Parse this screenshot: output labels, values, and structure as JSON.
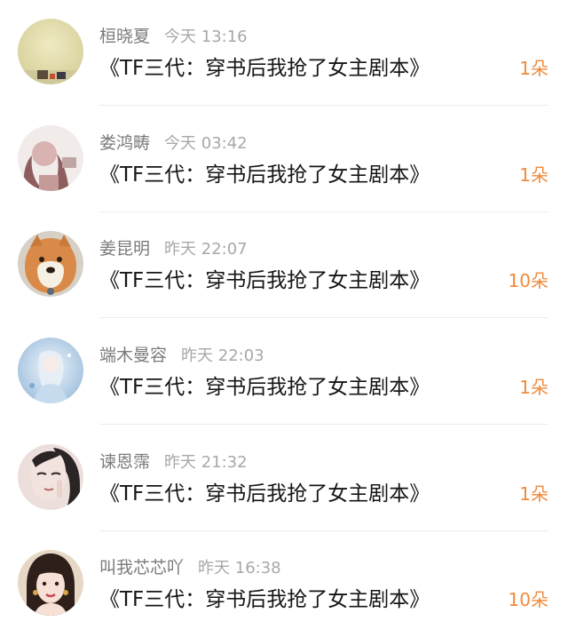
{
  "list": {
    "items": [
      {
        "name": "桓晓夏",
        "time": "今天 13:16",
        "title": "《TF三代：穿书后我抢了女主剧本》",
        "count": "1朵",
        "avatar_icon": "avatar-blurry-room-icon"
      },
      {
        "name": "娄鸿畴",
        "time": "今天 03:42",
        "title": "《TF三代：穿书后我抢了女主剧本》",
        "count": "1朵",
        "avatar_icon": "avatar-sketch-girl-icon"
      },
      {
        "name": "姜昆明",
        "time": "昨天 22:07",
        "title": "《TF三代：穿书后我抢了女主剧本》",
        "count": "10朵",
        "avatar_icon": "avatar-shiba-dog-icon"
      },
      {
        "name": "端木曼容",
        "time": "昨天 22:03",
        "title": "《TF三代：穿书后我抢了女主剧本》",
        "count": "1朵",
        "avatar_icon": "avatar-anime-girl-icon"
      },
      {
        "name": "谏恩霈",
        "time": "昨天 21:32",
        "title": "《TF三代：穿书后我抢了女主剧本》",
        "count": "1朵",
        "avatar_icon": "avatar-drawn-girl-icon"
      },
      {
        "name": "叫我芯芯吖",
        "time": "昨天 16:38",
        "title": "《TF三代：穿书后我抢了女主剧本》",
        "count": "10朵",
        "avatar_icon": "avatar-portrait-girl-icon"
      }
    ]
  },
  "colors": {
    "name": "#7b7b7b",
    "time": "#a8a8a8",
    "title": "#151515",
    "count_accent": "#f08a3c",
    "divider": "#ececec"
  }
}
